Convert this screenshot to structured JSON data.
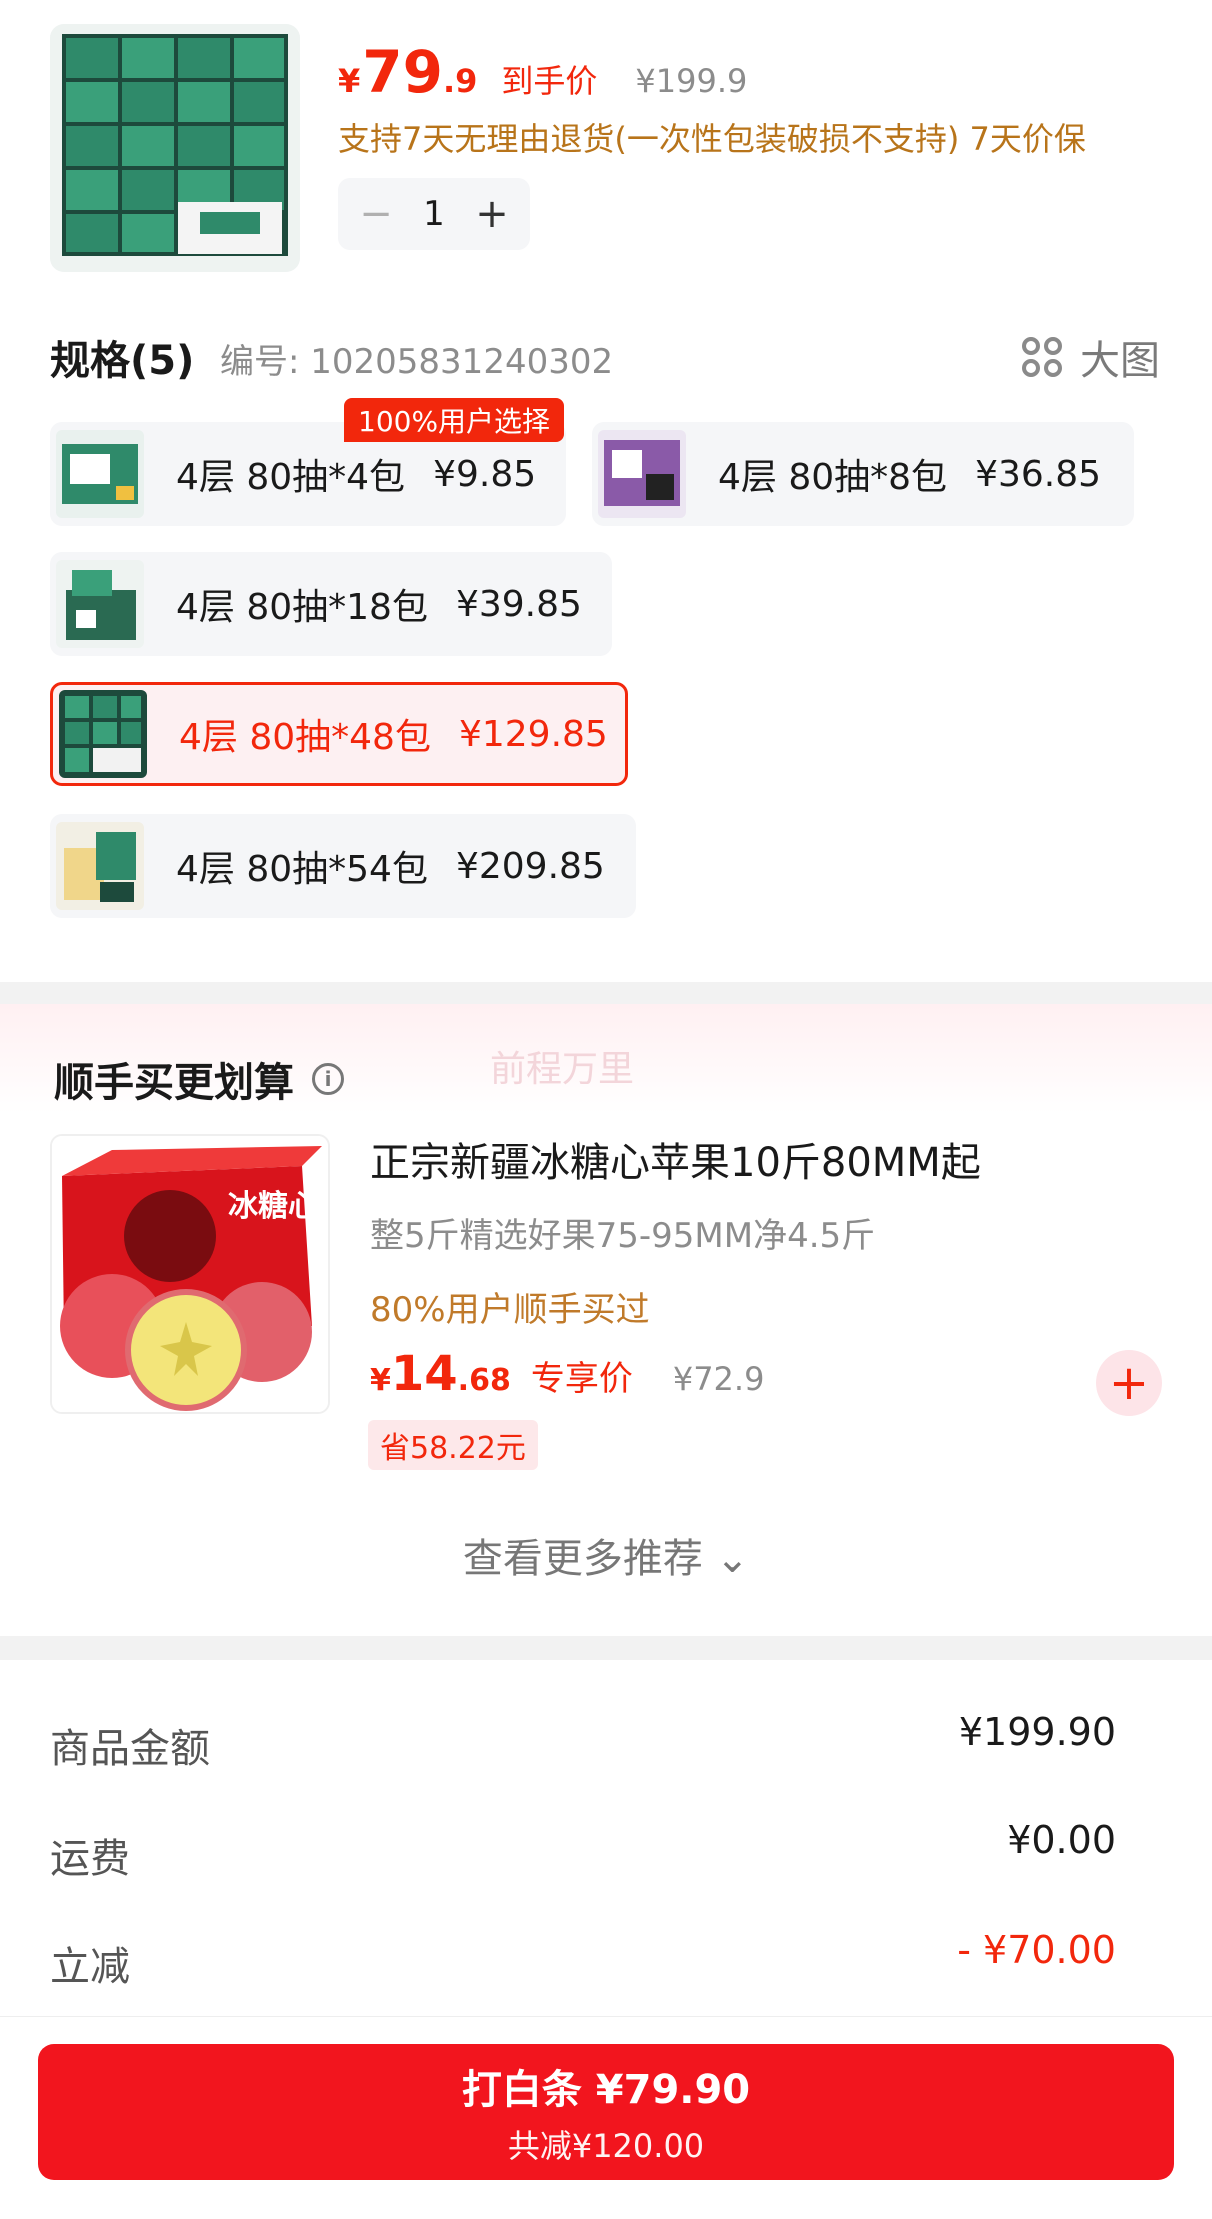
{
  "product": {
    "price_currency": "¥",
    "price_int": "79",
    "price_dec": ".9",
    "price_tag": "到手价",
    "price_original": "¥199.9",
    "promise": "支持7天无理由退货(一次性包装破损不支持) 7天价保",
    "quantity": "1",
    "minus": "−",
    "plus": "+"
  },
  "spec": {
    "title": "规格(5)",
    "code": "编号: 10205831240302",
    "big_image": "大图",
    "hot_badge": "100%用户选择",
    "options": [
      {
        "label": "4层 80抽*4包",
        "price": "¥9.85",
        "selected": false
      },
      {
        "label": "4层 80抽*8包",
        "price": "¥36.85",
        "selected": false
      },
      {
        "label": "4层 80抽*18包",
        "price": "¥39.85",
        "selected": false
      },
      {
        "label": "4层 80抽*48包",
        "price": "¥129.85",
        "selected": true
      },
      {
        "label": "4层 80抽*54包",
        "price": "¥209.85",
        "selected": false
      }
    ]
  },
  "recommend": {
    "title": "顺手买更划算",
    "info": "i",
    "watermark": "前程万里",
    "box_text": "冰糖心",
    "name": "正宗新疆冰糖心苹果10斤80MM起",
    "subtitle": "整5斤精选好果75-95MM净4.5斤",
    "social": "80%用户顺手买过",
    "price_currency": "¥",
    "price_int": "14",
    "price_dec": ".68",
    "price_tag": "专享价",
    "price_original": "¥72.9",
    "save": "省58.22元",
    "add": "+",
    "more": "查看更多推荐 ⌄"
  },
  "summary": {
    "rows": [
      {
        "label": "商品金额",
        "value": "¥199.90"
      },
      {
        "label": "运费",
        "value": "¥0.00"
      },
      {
        "label": "立减",
        "value": "- ¥70.00"
      }
    ]
  },
  "pay": {
    "main": "打白条 ¥79.90",
    "sub": "共减¥120.00"
  },
  "colors": {
    "accent": "#f2270c",
    "promise": "#b8741a",
    "muted": "#8c8c8c",
    "panel": "#f5f6f8"
  },
  "icons": [
    "minus-icon",
    "plus-icon",
    "grid-icon",
    "info-icon",
    "chevron-down-icon",
    "add-icon"
  ]
}
